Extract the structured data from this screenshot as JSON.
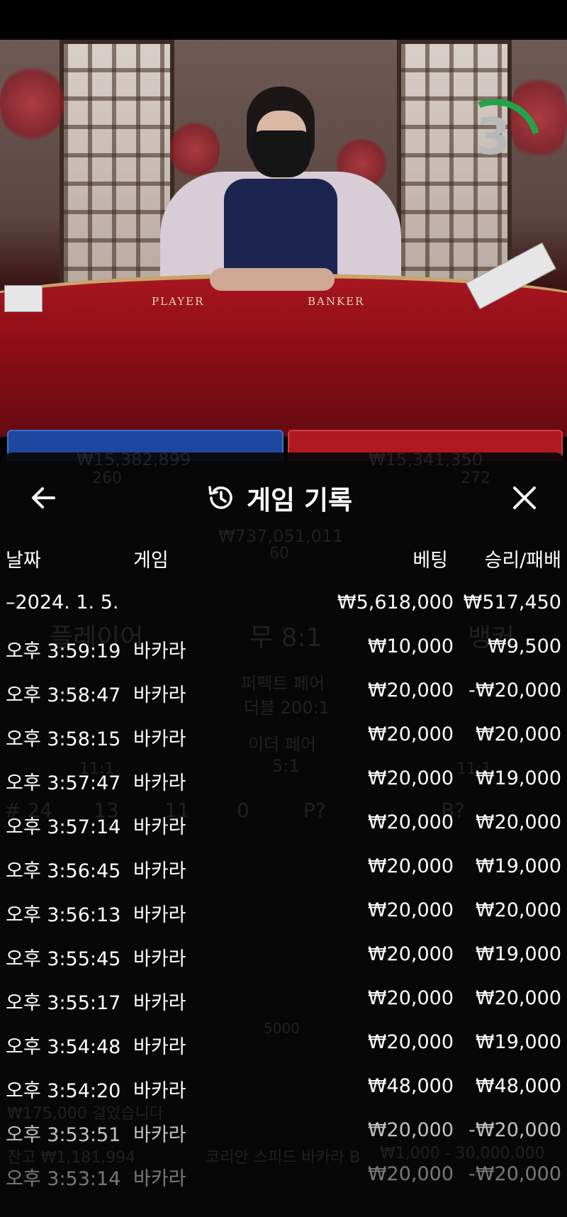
{
  "video": {
    "countdown": "3",
    "felt_left_label": "PLAYER",
    "felt_right_label": "BANKER"
  },
  "panel": {
    "title": "게임 기록",
    "back_icon": "arrow-left-icon",
    "history_icon": "history-icon",
    "close_icon": "close-icon"
  },
  "columns": {
    "date": "날짜",
    "game": "게임",
    "bet": "베팅",
    "result": "승리/패배"
  },
  "summary": {
    "date": "–2024. 1. 5.",
    "bet": "₩5,618,000",
    "result": "₩517,450"
  },
  "rows": [
    {
      "time": "오후 3:59:19",
      "game": "바카라",
      "bet": "₩10,000",
      "result": "₩9,500"
    },
    {
      "time": "오후 3:58:47",
      "game": "바카라",
      "bet": "₩20,000",
      "result": "-₩20,000"
    },
    {
      "time": "오후 3:58:15",
      "game": "바카라",
      "bet": "₩20,000",
      "result": "₩20,000"
    },
    {
      "time": "오후 3:57:47",
      "game": "바카라",
      "bet": "₩20,000",
      "result": "₩19,000"
    },
    {
      "time": "오후 3:57:14",
      "game": "바카라",
      "bet": "₩20,000",
      "result": "₩20,000"
    },
    {
      "time": "오후 3:56:45",
      "game": "바카라",
      "bet": "₩20,000",
      "result": "₩19,000"
    },
    {
      "time": "오후 3:56:13",
      "game": "바카라",
      "bet": "₩20,000",
      "result": "₩20,000"
    },
    {
      "time": "오후 3:55:45",
      "game": "바카라",
      "bet": "₩20,000",
      "result": "₩19,000"
    },
    {
      "time": "오후 3:55:17",
      "game": "바카라",
      "bet": "₩20,000",
      "result": "₩20,000"
    },
    {
      "time": "오후 3:54:48",
      "game": "바카라",
      "bet": "₩20,000",
      "result": "₩19,000"
    },
    {
      "time": "오후 3:54:20",
      "game": "바카라",
      "bet": "₩48,000",
      "result": "₩48,000"
    },
    {
      "time": "오후 3:53:51",
      "game": "바카라",
      "bet": "₩20,000",
      "result": "-₩20,000"
    },
    {
      "time": "오후 3:53:14",
      "game": "바카라",
      "bet": "₩20,000",
      "result": "-₩20,000"
    }
  ],
  "background_ghost": {
    "left_amount": "₩15,382,899",
    "left_count": "260",
    "right_amount": "₩15,341,350",
    "right_count": "272",
    "center_amount": "₩737,051,011",
    "center_count": "60",
    "player": "플레이어",
    "tie": "무 8:1",
    "banker": "뱅커",
    "perfect_pair": "퍼펙트 페어",
    "perfect_pair_odds": "더블 200:1",
    "either_pair": "이더 페어",
    "either_pair_odds": "5:1",
    "pair_odds_left": "11:1",
    "pair_odds_right": "11:1",
    "round_count": "# 24",
    "player_count": "13",
    "banker_count": "11",
    "tie_count": "0",
    "player_ask": "P?",
    "banker_ask": "B?",
    "chip_value": "5000",
    "balance_label": "잔고 ₩1,181,994",
    "table_name": "코리안 스피드 바카라 B",
    "limits": "₩1,000 - 30,000,000",
    "total_bet": "₩175,000 걸었습니다"
  },
  "colors": {
    "overlay": "#080808",
    "player_blue": "#1e47a0",
    "banker_red": "#b01822",
    "timer_green": "#22a34a"
  }
}
